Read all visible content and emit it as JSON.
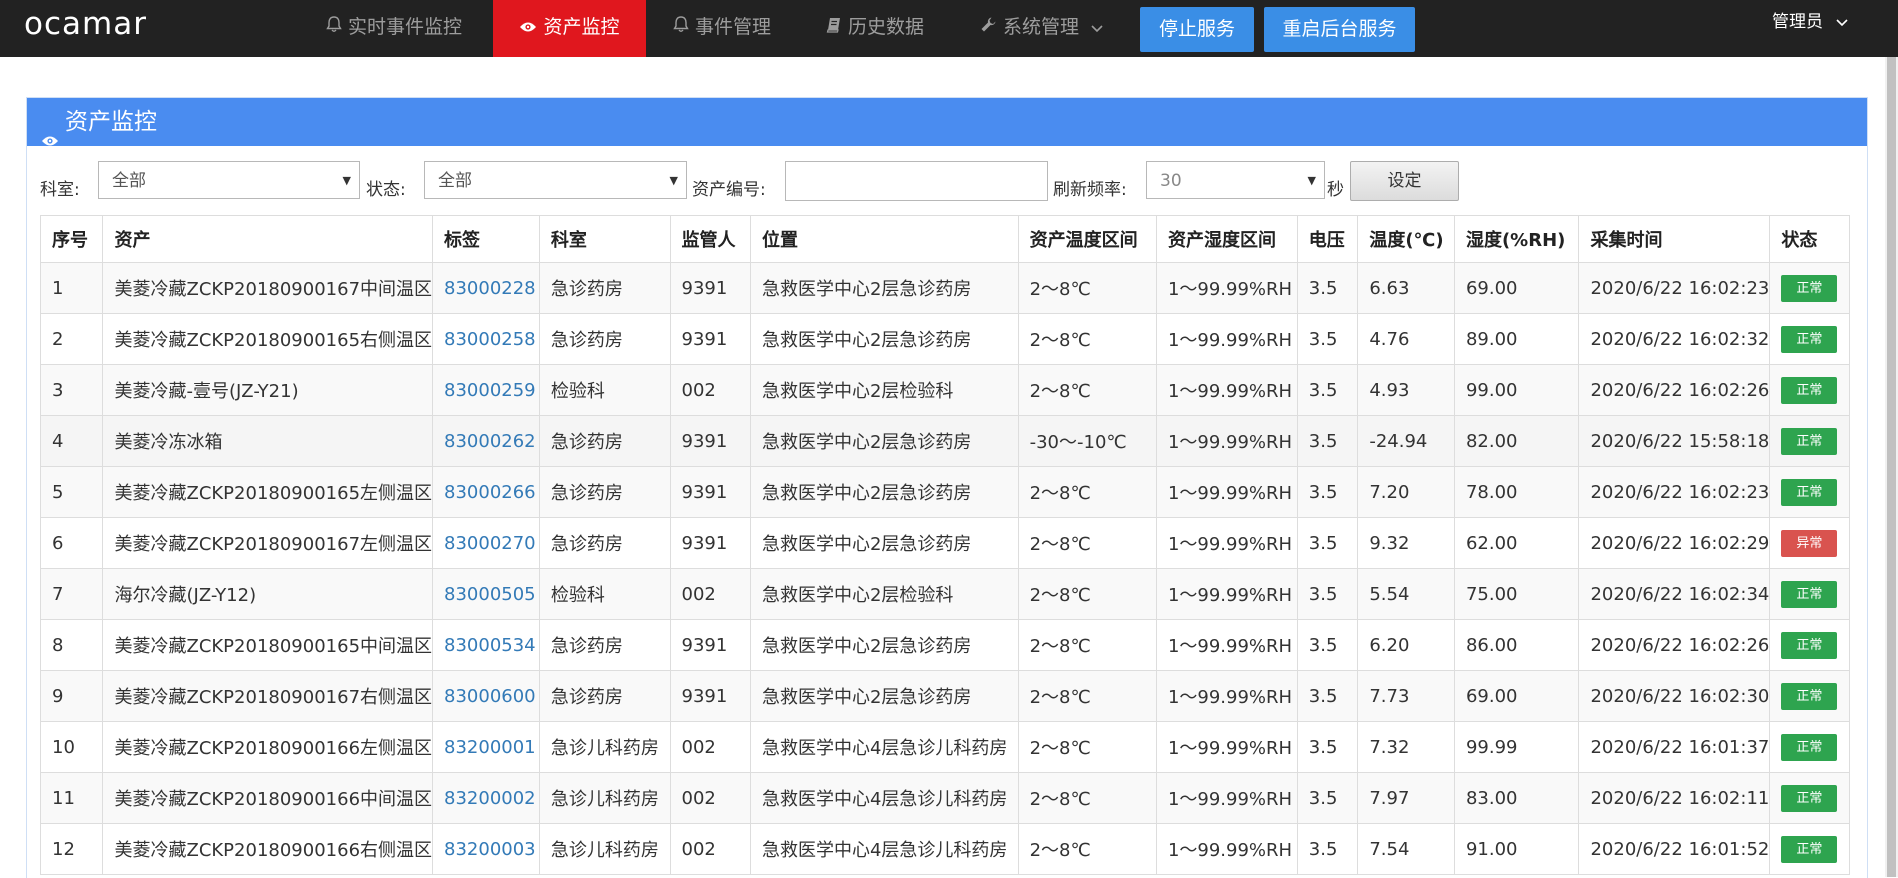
{
  "brand": {
    "logo_text": "ocamar"
  },
  "nav": {
    "items": [
      {
        "label": "实时事件监控",
        "icon": "bell-icon"
      },
      {
        "label": "资产监控",
        "icon": "eye-icon",
        "active": true
      },
      {
        "label": "事件管理",
        "icon": "bell-icon"
      },
      {
        "label": "历史数据",
        "icon": "book-icon"
      },
      {
        "label": "系统管理",
        "icon": "wrench-icon",
        "dropdown": true
      }
    ],
    "buttons": {
      "stop_service": "停止服务",
      "restart_service": "重启后台服务"
    },
    "user_label": "管理员"
  },
  "panel": {
    "title": "资产监控"
  },
  "filters": {
    "department_label": "科室:",
    "department_value": "全部",
    "status_label": "状态:",
    "status_value": "全部",
    "asset_no_label": "资产编号:",
    "asset_no_value": "",
    "refresh_label": "刷新频率:",
    "refresh_value": "30",
    "refresh_unit": "秒",
    "set_button": "设定"
  },
  "table": {
    "headers": [
      "序号",
      "资产",
      "标签",
      "科室",
      "监管人",
      "位置",
      "资产温度区间",
      "资产湿度区间",
      "电压",
      "温度(℃)",
      "湿度(%RH)",
      "采集时间",
      "状态"
    ],
    "rows": [
      {
        "no": "1",
        "asset": "美菱冷藏ZCKP20180900167中间温区",
        "tag": "83000228",
        "dept": "急诊药房",
        "keeper": "9391",
        "location": "急救医学中心2层急诊药房",
        "temp_range": "2～8℃",
        "hum_range": "1～99.99%RH",
        "voltage": "3.5",
        "temp": "6.63",
        "hum": "69.00",
        "time": "2020/6/22 16:02:23",
        "status": "正常",
        "status_color": "#2ea44f"
      },
      {
        "no": "2",
        "asset": "美菱冷藏ZCKP20180900165右侧温区",
        "tag": "83000258",
        "dept": "急诊药房",
        "keeper": "9391",
        "location": "急救医学中心2层急诊药房",
        "temp_range": "2～8℃",
        "hum_range": "1～99.99%RH",
        "voltage": "3.5",
        "temp": "4.76",
        "hum": "89.00",
        "time": "2020/6/22 16:02:32",
        "status": "正常",
        "status_color": "#2ea44f"
      },
      {
        "no": "3",
        "asset": "美菱冷藏-壹号(JZ-Y21)",
        "tag": "83000259",
        "dept": "检验科",
        "keeper": "002",
        "location": "急救医学中心2层检验科",
        "temp_range": "2～8℃",
        "hum_range": "1～99.99%RH",
        "voltage": "3.5",
        "temp": "4.93",
        "hum": "99.00",
        "time": "2020/6/22 16:02:26",
        "status": "正常",
        "status_color": "#2ea44f"
      },
      {
        "no": "4",
        "asset": "美菱冷冻冰箱",
        "tag": "83000262",
        "dept": "急诊药房",
        "keeper": "9391",
        "location": "急救医学中心2层急诊药房",
        "temp_range": "-30～-10℃",
        "hum_range": "1～99.99%RH",
        "voltage": "3.5",
        "temp": "-24.94",
        "hum": "82.00",
        "time": "2020/6/22 15:58:18",
        "status": "正常",
        "status_color": "#2ea44f"
      },
      {
        "no": "5",
        "asset": "美菱冷藏ZCKP20180900165左侧温区",
        "tag": "83000266",
        "dept": "急诊药房",
        "keeper": "9391",
        "location": "急救医学中心2层急诊药房",
        "temp_range": "2～8℃",
        "hum_range": "1～99.99%RH",
        "voltage": "3.5",
        "temp": "7.20",
        "hum": "78.00",
        "time": "2020/6/22 16:02:23",
        "status": "正常",
        "status_color": "#2ea44f"
      },
      {
        "no": "6",
        "asset": "美菱冷藏ZCKP20180900167左侧温区",
        "tag": "83000270",
        "dept": "急诊药房",
        "keeper": "9391",
        "location": "急救医学中心2层急诊药房",
        "temp_range": "2～8℃",
        "hum_range": "1～99.99%RH",
        "voltage": "3.5",
        "temp": "9.32",
        "hum": "62.00",
        "time": "2020/6/22 16:02:29",
        "status": "异常",
        "status_color": "#d9534f"
      },
      {
        "no": "7",
        "asset": "海尔冷藏(JZ-Y12)",
        "tag": "83000505",
        "dept": "检验科",
        "keeper": "002",
        "location": "急救医学中心2层检验科",
        "temp_range": "2～8℃",
        "hum_range": "1～99.99%RH",
        "voltage": "3.5",
        "temp": "5.54",
        "hum": "75.00",
        "time": "2020/6/22 16:02:34",
        "status": "正常",
        "status_color": "#2ea44f"
      },
      {
        "no": "8",
        "asset": "美菱冷藏ZCKP20180900165中间温区",
        "tag": "83000534",
        "dept": "急诊药房",
        "keeper": "9391",
        "location": "急救医学中心2层急诊药房",
        "temp_range": "2～8℃",
        "hum_range": "1～99.99%RH",
        "voltage": "3.5",
        "temp": "6.20",
        "hum": "86.00",
        "time": "2020/6/22 16:02:26",
        "status": "正常",
        "status_color": "#2ea44f"
      },
      {
        "no": "9",
        "asset": "美菱冷藏ZCKP20180900167右侧温区",
        "tag": "83000600",
        "dept": "急诊药房",
        "keeper": "9391",
        "location": "急救医学中心2层急诊药房",
        "temp_range": "2～8℃",
        "hum_range": "1～99.99%RH",
        "voltage": "3.5",
        "temp": "7.73",
        "hum": "69.00",
        "time": "2020/6/22 16:02:30",
        "status": "正常",
        "status_color": "#2ea44f"
      },
      {
        "no": "10",
        "asset": "美菱冷藏ZCKP20180900166左侧温区",
        "tag": "83200001",
        "dept": "急诊儿科药房",
        "keeper": "002",
        "location": "急救医学中心4层急诊儿科药房",
        "temp_range": "2～8℃",
        "hum_range": "1～99.99%RH",
        "voltage": "3.5",
        "temp": "7.32",
        "hum": "99.99",
        "time": "2020/6/22 16:01:37",
        "status": "正常",
        "status_color": "#2ea44f"
      },
      {
        "no": "11",
        "asset": "美菱冷藏ZCKP20180900166中间温区",
        "tag": "83200002",
        "dept": "急诊儿科药房",
        "keeper": "002",
        "location": "急救医学中心4层急诊儿科药房",
        "temp_range": "2～8℃",
        "hum_range": "1～99.99%RH",
        "voltage": "3.5",
        "temp": "7.97",
        "hum": "83.00",
        "time": "2020/6/22 16:02:11",
        "status": "正常",
        "status_color": "#2ea44f"
      },
      {
        "no": "12",
        "asset": "美菱冷藏ZCKP20180900166右侧温区",
        "tag": "83200003",
        "dept": "急诊儿科药房",
        "keeper": "002",
        "location": "急救医学中心4层急诊儿科药房",
        "temp_range": "2～8℃",
        "hum_range": "1～99.99%RH",
        "voltage": "3.5",
        "temp": "7.54",
        "hum": "91.00",
        "time": "2020/6/22 16:01:52",
        "status": "正常",
        "status_color": "#2ea44f"
      }
    ]
  },
  "colors": {
    "topbar": "#222222",
    "nav_active": "#e0171e",
    "button_blue": "#3a8ee6",
    "panel_header": "#4a8cf0",
    "status_ok": "#2ea44f",
    "status_alarm": "#d9534f",
    "link": "#337ab7"
  }
}
